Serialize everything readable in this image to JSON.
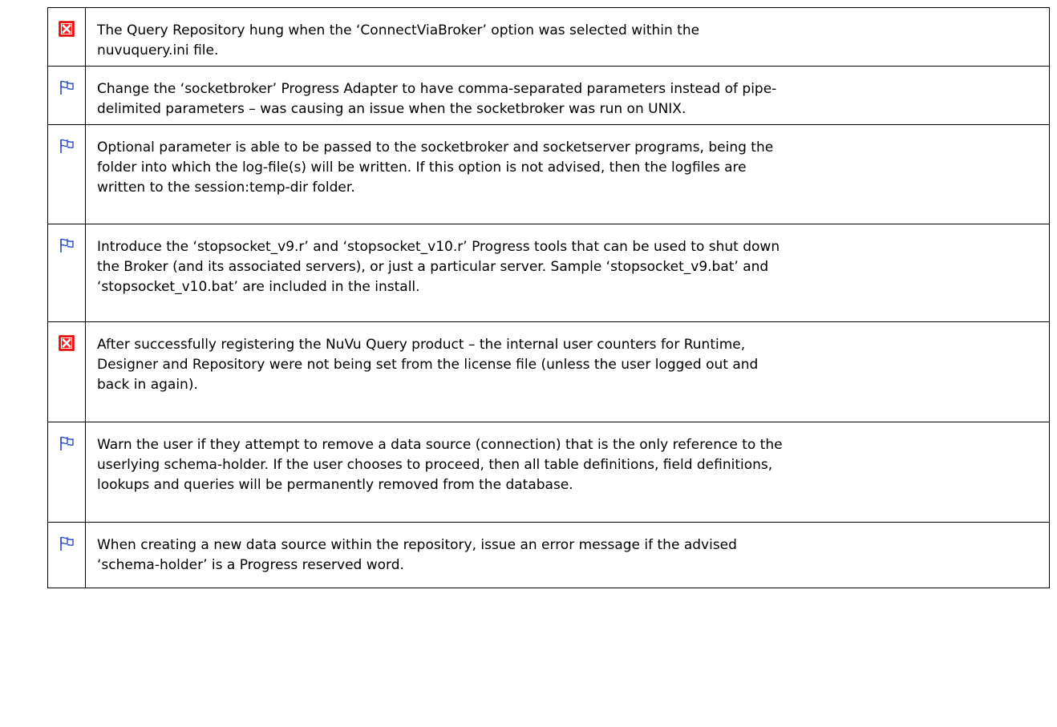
{
  "icon_colors": {
    "bug": "#e00000",
    "bug_fill": "#ff1a1a",
    "enhancement": "#2a4cc8"
  },
  "rows": [
    {
      "icon": "red-x-bug-icon",
      "text": "The Query Repository hung when the ‘ConnectViaBroker’ option was selected within the\nnuvuquery.ini file."
    },
    {
      "icon": "blue-flag-enhancement-icon",
      "text": "Change the ‘socketbroker’ Progress Adapter to have comma-separated parameters instead of pipe-\ndelimited parameters – was causing an issue when the socketbroker was run on UNIX."
    },
    {
      "icon": "blue-flag-enhancement-icon",
      "text": "Optional parameter is able to be passed to the socketbroker and socketserver programs, being the\nfolder into which the log-file(s) will be written.  If this option is not advised, then the logfiles are\nwritten to the session:temp-dir folder."
    },
    {
      "icon": "blue-flag-enhancement-icon",
      "text": "Introduce the ‘stopsocket_v9.r’ and ‘stopsocket_v10.r’ Progress tools that can be used to shut down\nthe Broker (and its associated servers), or just a particular server.  Sample ‘stopsocket_v9.bat’ and\n‘stopsocket_v10.bat’ are included in the install."
    },
    {
      "icon": "red-x-bug-icon",
      "text": "After successfully registering the NuVu Query product – the internal user counters for Runtime,\nDesigner and Repository were not being set from the license file (unless the user logged out and\nback in again)."
    },
    {
      "icon": "blue-flag-enhancement-icon",
      "text": "Warn the user if they attempt to remove a data source (connection) that is the only reference to the\nuserlying schema-holder.  If the user chooses to proceed, then all table definitions, field definitions,\nlookups and queries will be permanently removed from the database."
    },
    {
      "icon": "blue-flag-enhancement-icon",
      "text": "When creating a new data source within the repository, issue an error message if the advised\n‘schema-holder’ is a Progress reserved word."
    }
  ]
}
